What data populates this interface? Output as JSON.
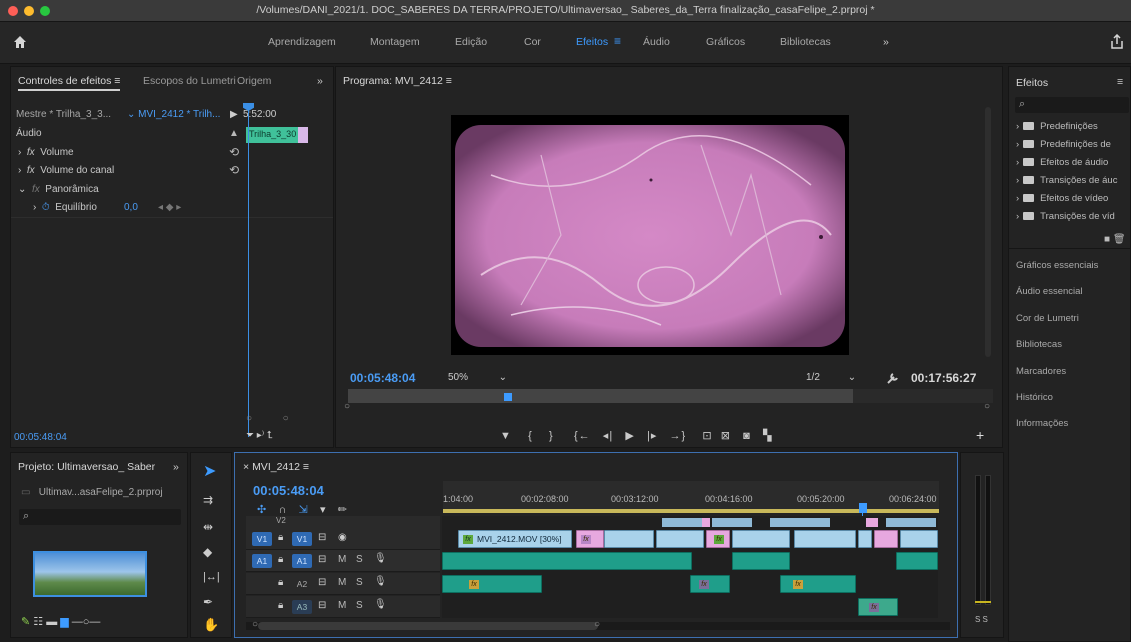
{
  "window": {
    "title": "/Volumes/DANI_2021/1. DOC_SABERES DA TERRA/PROJETO/Ultimaversao_ Saberes_da_Terra finalização_casaFelipe_2.prproj *"
  },
  "workspaces": {
    "items": [
      "Aprendizagem",
      "Montagem",
      "Edição",
      "Cor",
      "Efeitos",
      "Áudio",
      "Gráficos",
      "Bibliotecas"
    ],
    "active": "Efeitos",
    "more": "»"
  },
  "effect_controls": {
    "tabs": [
      "Controles de efeitos",
      "Escopos do Lumetri",
      "Origem"
    ],
    "more": "»",
    "master_label": "Mestre * Trilha_3_3...",
    "clip_label": "MVI_2412 * Trilh...",
    "timecode_top": "5:52:00",
    "clip_name": "Trilha_3_30",
    "section": "Áudio",
    "effects": [
      {
        "fx": "fx",
        "name": "Volume"
      },
      {
        "fx": "fx",
        "name": "Volume do canal"
      },
      {
        "fx": "fx",
        "name": "Panorâmica"
      }
    ],
    "param_name": "Equilíbrio",
    "param_value": "0,0",
    "current_time": "00:05:48:04"
  },
  "program": {
    "title": "Programa: MVI_2412",
    "timecode": "00:05:48:04",
    "zoom": "50%",
    "resolution": "1/2",
    "duration": "00:17:56:27"
  },
  "project": {
    "title": "Projeto: Ultimaversao_ Saber",
    "file": "Ultimav...asaFelipe_2.prproj",
    "more": "»"
  },
  "timeline": {
    "sequence": "MVI_2412",
    "timecode": "00:05:48:04",
    "ruler": [
      "1:04:00",
      "00:02:08:00",
      "00:03:12:00",
      "00:04:16:00",
      "00:05:20:00",
      "00:06:24:00"
    ],
    "tracks": [
      {
        "name": "V2",
        "src": ""
      },
      {
        "name": "V1",
        "src": "V1"
      },
      {
        "name": "A1",
        "src": "A1"
      },
      {
        "name": "A2",
        "src": ""
      },
      {
        "name": "A3",
        "src": ""
      }
    ],
    "video_clip": "MVI_2412.MOV [30%]",
    "mute": "M",
    "solo": "S",
    "meter_label": "S S"
  },
  "effects_panel": {
    "title": "Efeitos",
    "items": [
      "Predefinições",
      "Predefinições de",
      "Efeitos de áudio",
      "Transições de áuc",
      "Efeitos de vídeo",
      "Transições de víd"
    ]
  },
  "side_panels": [
    "Gráficos essenciais",
    "Áudio essencial",
    "Cor de Lumetri",
    "Bibliotecas",
    "Marcadores",
    "Histórico",
    "Informações"
  ],
  "colors": {
    "accent": "#3d9bff",
    "video_clip": "#a9d2ea",
    "pink_clip": "#e7a8df",
    "audio_clip": "#1f9e8a",
    "frame_pink": "#c97dba"
  }
}
